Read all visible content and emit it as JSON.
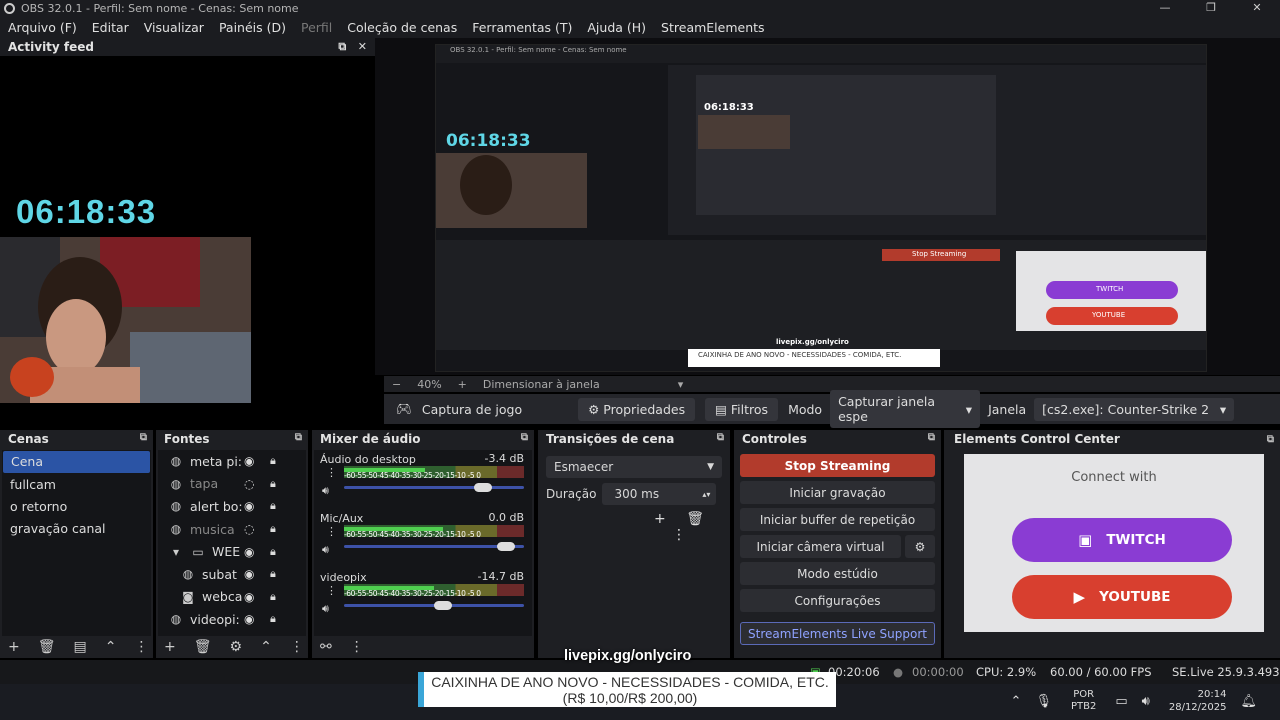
{
  "window": {
    "title": "OBS 32.0.1 - Perfil: Sem nome - Cenas: Sem nome"
  },
  "menu": [
    "Arquivo (F)",
    "Editar",
    "Visualizar",
    "Painéis (D)",
    "Perfil",
    "Coleção de cenas",
    "Ferramentas (T)",
    "Ajuda (H)",
    "StreamElements"
  ],
  "activity": {
    "title": "Activity feed",
    "clock": "06:18:33"
  },
  "preview": {
    "clock": "06:18:33",
    "zoom": "40%",
    "fit_label": "Dimensionar à janela"
  },
  "source_bar": {
    "source": "Captura de jogo",
    "properties": "Propriedades",
    "filters": "Filtros",
    "mode_label": "Modo",
    "mode_value": "Capturar janela espe",
    "window_label": "Janela",
    "window_value": "[cs2.exe]: Counter-Strike 2"
  },
  "scenes": {
    "title": "Cenas",
    "items": [
      "Cena",
      "fullcam",
      "o retorno",
      "gravação canal"
    ]
  },
  "sources": {
    "title": "Fontes",
    "items": [
      "meta pi:",
      "tapa",
      "alert bo:",
      "musica",
      "WEE",
      "subat",
      "webca",
      "videopi:"
    ]
  },
  "mixer": {
    "title": "Mixer de áudio",
    "ticks": "-60-55-50-45-40-35-30-25-20-15-10 -5  0",
    "channels": [
      {
        "name": "Áudio do desktop",
        "db": "-3.4 dB",
        "level": 0.45,
        "volume": 0.82
      },
      {
        "name": "Mic/Aux",
        "db": "0.0 dB",
        "level": 0.55,
        "volume": 0.95
      },
      {
        "name": "videopix",
        "db": "-14.7 dB",
        "level": 0.5,
        "volume": 0.6
      }
    ]
  },
  "transitions": {
    "title": "Transições de cena",
    "selected": "Esmaecer",
    "duration_label": "Duração",
    "duration_value": "300 ms"
  },
  "controls": {
    "title": "Controles",
    "stop": "Stop Streaming",
    "record": "Iniciar gravação",
    "replay": "Iniciar buffer de repetição",
    "virtualcam": "Iniciar câmera virtual",
    "studio": "Modo estúdio",
    "settings": "Configurações",
    "support": "StreamElements Live Support"
  },
  "ecc": {
    "title": "Elements Control Center",
    "connect": "Connect with",
    "twitch": "TWITCH",
    "youtube": "YOUTUBE"
  },
  "status": {
    "time1": "00:20:06",
    "time2": "00:00:00",
    "cpu": "CPU: 2.9%",
    "fps": "60.00 / 60.00 FPS",
    "version": "SE.Live 25.9.3.493"
  },
  "tray": {
    "lang1": "POR",
    "lang2": "PTB2",
    "time": "20:14",
    "date": "28/12/2025"
  },
  "overlay": {
    "livepix": "livepix.gg/onlyciro",
    "banner1": "CAIXINHA DE ANO NOVO - NECESSIDADES - COMIDA, ETC.",
    "banner2": "(R$ 10,00/R$ 200,00)"
  },
  "colors": {
    "accent": "#2b54a5",
    "stop": "#b23b2c",
    "twitch": "#8a3cd3",
    "youtube": "#d83f2f",
    "clock": "#5fd6e6"
  }
}
